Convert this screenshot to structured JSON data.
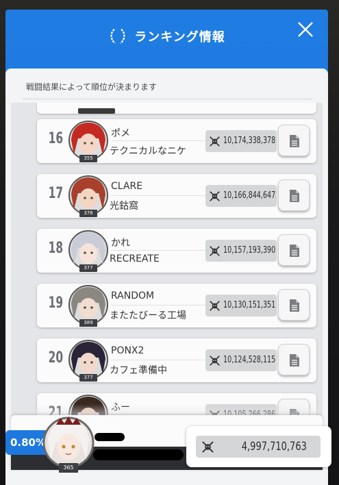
{
  "header": {
    "title": "ランキング情報",
    "subtitle": "戦闘結果によって順位が決まります"
  },
  "icons": {
    "title": "laurel-icon",
    "close": "close-icon",
    "score": "crossed-swords-skull-icon",
    "detail": "document-icon"
  },
  "rankings": [
    {
      "rank": "16",
      "name": "ポメ",
      "guild": "テクニカルなニケ",
      "level": "355",
      "score": "10,174,338,378",
      "hair": "#c42a22",
      "skin": "#f5d6c6"
    },
    {
      "rank": "17",
      "name": "CLARE",
      "guild": "光鈷窩",
      "level": "376",
      "score": "10,166,844,647",
      "hair": "#a8402c",
      "skin": "#f3d5c4"
    },
    {
      "rank": "18",
      "name": "かれ",
      "guild": "RECREATE",
      "level": "377",
      "score": "10,157,193,390",
      "hair": "#c9ccd6",
      "skin": "#f6e4da"
    },
    {
      "rank": "19",
      "name": "RANDOM",
      "guild": "またたびーる工場",
      "level": "389",
      "score": "10,130,151,351",
      "hair": "#8c8780",
      "skin": "#f0dcd0"
    },
    {
      "rank": "20",
      "name": "PONX2",
      "guild": "カフェ準備中",
      "level": "377",
      "score": "10,124,528,115",
      "hair": "#2b2438",
      "skin": "#f2d8ca"
    },
    {
      "rank": "21",
      "name": "ふー",
      "guild": "",
      "level": "",
      "score": "10,105,266,286",
      "hair": "#3a2820",
      "skin": "#e9cdbd"
    }
  ],
  "my_rank": {
    "percent": "0.80%",
    "level": "365",
    "score": "4,997,710,763"
  },
  "colors": {
    "accent": "#1f7ce2",
    "panel": "#f3f4f6",
    "score_bg": "#d5d6d8"
  }
}
